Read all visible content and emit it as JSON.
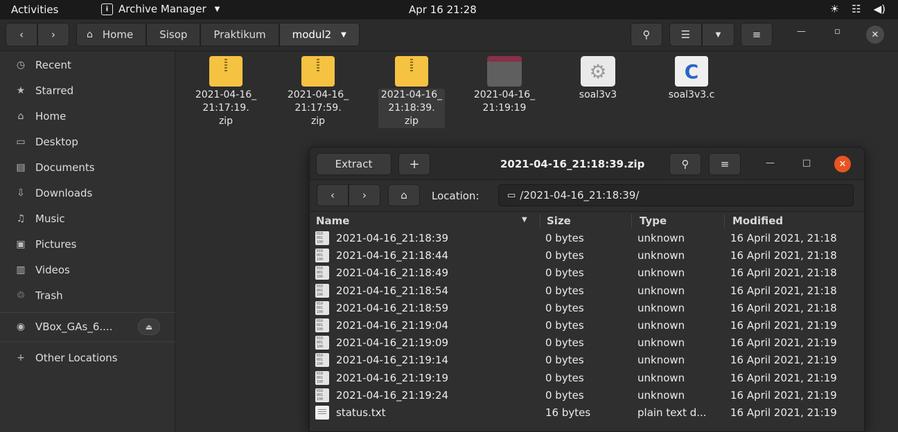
{
  "topbar": {
    "activities": "Activities",
    "app_name": "Archive Manager",
    "clock": "Apr 16  21:28"
  },
  "nautilus": {
    "path": [
      "Home",
      "Sisop",
      "Praktikum",
      "modul2"
    ]
  },
  "sidebar": {
    "items": [
      {
        "label": "Recent",
        "icon": "clock-icon"
      },
      {
        "label": "Starred",
        "icon": "star-icon"
      },
      {
        "label": "Home",
        "icon": "home-icon"
      },
      {
        "label": "Desktop",
        "icon": "desktop-icon"
      },
      {
        "label": "Documents",
        "icon": "documents-icon"
      },
      {
        "label": "Downloads",
        "icon": "downloads-icon"
      },
      {
        "label": "Music",
        "icon": "music-icon"
      },
      {
        "label": "Pictures",
        "icon": "pictures-icon"
      },
      {
        "label": "Videos",
        "icon": "videos-icon"
      },
      {
        "label": "Trash",
        "icon": "trash-icon"
      }
    ],
    "device": "VBox_GAs_6....",
    "other_locations": "Other Locations"
  },
  "files": [
    {
      "line1": "2021-04-16_",
      "line2": "21:17:19.",
      "line3": "zip",
      "kind": "zip"
    },
    {
      "line1": "2021-04-16_",
      "line2": "21:17:59.",
      "line3": "zip",
      "kind": "zip"
    },
    {
      "line1": "2021-04-16_",
      "line2": "21:18:39.",
      "line3": "zip",
      "kind": "zip"
    },
    {
      "line1": "2021-04-16_",
      "line2": "21:19:19",
      "line3": "",
      "kind": "folder"
    },
    {
      "line1": "soal3v3",
      "line2": "",
      "line3": "",
      "kind": "executable"
    },
    {
      "line1": "soal3v3.c",
      "line2": "",
      "line3": "",
      "kind": "c-source"
    }
  ],
  "archive": {
    "extract_label": "Extract",
    "add_label": "+",
    "title": "2021-04-16_21:18:39.zip",
    "location_label": "Location:",
    "location_value": "/2021-04-16_21:18:39/",
    "columns": {
      "name": "Name",
      "size": "Size",
      "type": "Type",
      "modified": "Modified"
    },
    "rows": [
      {
        "name": "2021-04-16_21:18:39",
        "size": "0 bytes",
        "type": "unknown",
        "modified": "16 April 2021, 21:18",
        "icon": "binary-icon"
      },
      {
        "name": "2021-04-16_21:18:44",
        "size": "0 bytes",
        "type": "unknown",
        "modified": "16 April 2021, 21:18",
        "icon": "binary-icon"
      },
      {
        "name": "2021-04-16_21:18:49",
        "size": "0 bytes",
        "type": "unknown",
        "modified": "16 April 2021, 21:18",
        "icon": "binary-icon"
      },
      {
        "name": "2021-04-16_21:18:54",
        "size": "0 bytes",
        "type": "unknown",
        "modified": "16 April 2021, 21:18",
        "icon": "binary-icon"
      },
      {
        "name": "2021-04-16_21:18:59",
        "size": "0 bytes",
        "type": "unknown",
        "modified": "16 April 2021, 21:18",
        "icon": "binary-icon"
      },
      {
        "name": "2021-04-16_21:19:04",
        "size": "0 bytes",
        "type": "unknown",
        "modified": "16 April 2021, 21:19",
        "icon": "binary-icon"
      },
      {
        "name": "2021-04-16_21:19:09",
        "size": "0 bytes",
        "type": "unknown",
        "modified": "16 April 2021, 21:19",
        "icon": "binary-icon"
      },
      {
        "name": "2021-04-16_21:19:14",
        "size": "0 bytes",
        "type": "unknown",
        "modified": "16 April 2021, 21:19",
        "icon": "binary-icon"
      },
      {
        "name": "2021-04-16_21:19:19",
        "size": "0 bytes",
        "type": "unknown",
        "modified": "16 April 2021, 21:19",
        "icon": "binary-icon"
      },
      {
        "name": "2021-04-16_21:19:24",
        "size": "0 bytes",
        "type": "unknown",
        "modified": "16 April 2021, 21:19",
        "icon": "binary-icon"
      },
      {
        "name": "status.txt",
        "size": "16 bytes",
        "type": "plain text d...",
        "modified": "16 April 2021, 21:19",
        "icon": "text-file-icon"
      }
    ]
  },
  "colors": {
    "accent_close": "#e95420",
    "zip": "#f5c242",
    "folder_tab": "#8a3048"
  }
}
